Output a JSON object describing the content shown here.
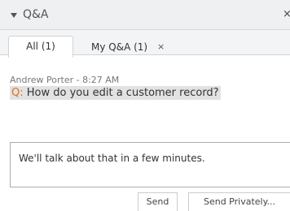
{
  "panel": {
    "title": "Q&A",
    "close_glyph": "×"
  },
  "tabs": [
    {
      "label": "All (1)",
      "active": true
    },
    {
      "label": "My Q&A (1)",
      "active": false,
      "close_glyph": "×"
    }
  ],
  "message": {
    "author_time": "Andrew Porter - 8:27 AM",
    "prefix": "Q:",
    "question": "How do you edit a customer record?"
  },
  "reply": {
    "value": "We'll talk about that in a few minutes."
  },
  "buttons": {
    "send": "Send",
    "send_privately": "Send Privately..."
  },
  "colors": {
    "question_prefix": "#e36e1c",
    "question_highlight": "#e2e2e2",
    "header_bg": "#eef0f2"
  },
  "icons": {
    "collapse": "collapse-triangle-icon",
    "close": "close-icon"
  }
}
